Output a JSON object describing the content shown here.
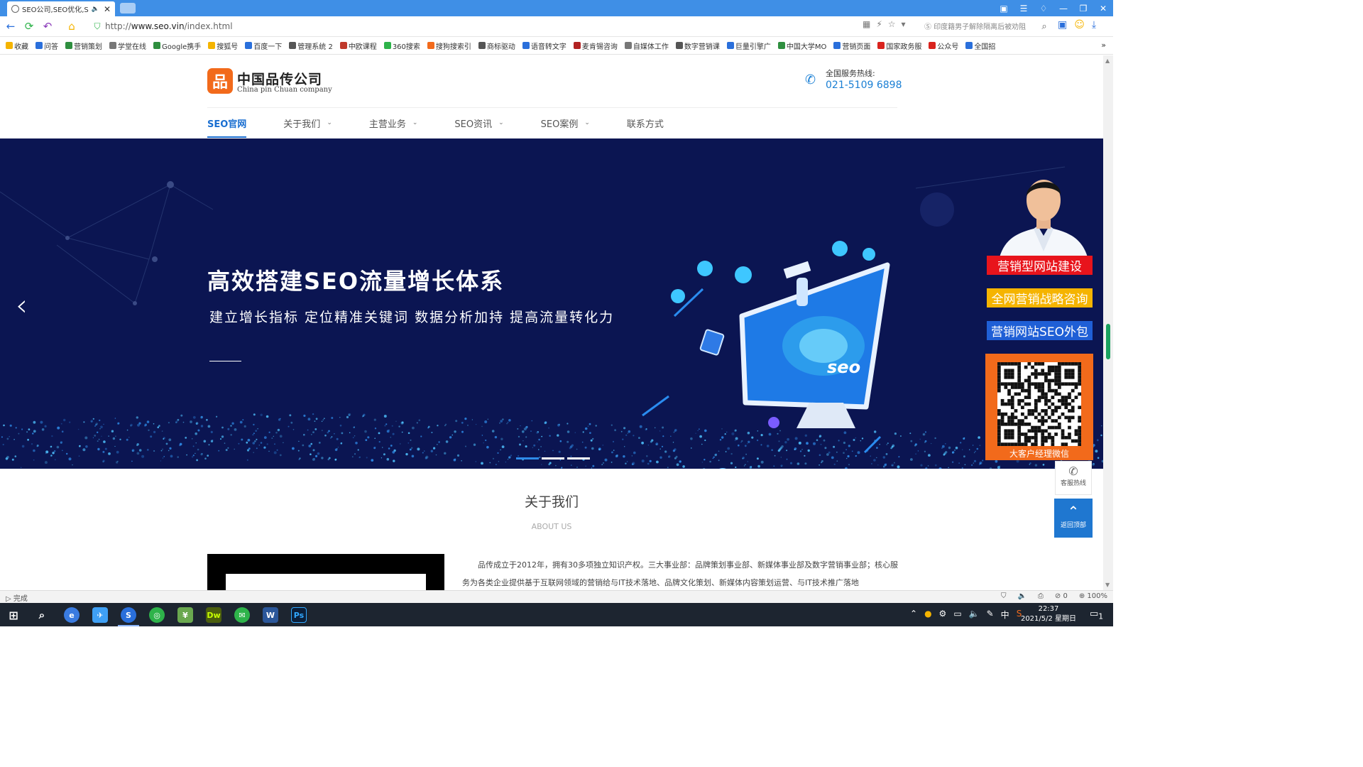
{
  "browser": {
    "tab_title": "SEO公司,SEO优化,S",
    "url_prefix": "http://",
    "url_host": "www.seo.vin",
    "url_path": "/index.html",
    "search_hint": "印度籍男子解除隔离后被劝阻",
    "status_text": "完成",
    "zoom": "100%",
    "adblock_count": "0"
  },
  "bookmarks": [
    {
      "label": "收藏",
      "color": "#f5b400"
    },
    {
      "label": "问答",
      "color": "#2a6fdb"
    },
    {
      "label": "营销策划",
      "color": "#2f8f3f"
    },
    {
      "label": "学堂在线",
      "color": "#777777"
    },
    {
      "label": "Google携手",
      "color": "#2f8f3f"
    },
    {
      "label": "搜狐号",
      "color": "#f5b400"
    },
    {
      "label": "百度一下",
      "color": "#2a6fdb"
    },
    {
      "label": "管理系统 2",
      "color": "#555555"
    },
    {
      "label": "中欧课程",
      "color": "#c0392b"
    },
    {
      "label": "360搜索",
      "color": "#2eb34a"
    },
    {
      "label": "搜狗搜索引",
      "color": "#f26a1b"
    },
    {
      "label": "商标驱动",
      "color": "#555555"
    },
    {
      "label": "语音转文字",
      "color": "#2a6fdb"
    },
    {
      "label": "麦肯锡咨询",
      "color": "#b22222"
    },
    {
      "label": "自媒体工作",
      "color": "#777777"
    },
    {
      "label": "数字营销课",
      "color": "#555555"
    },
    {
      "label": "巨量引擎广",
      "color": "#2a6fdb"
    },
    {
      "label": "中国大学MO",
      "color": "#2f8f3f"
    },
    {
      "label": "营销页面",
      "color": "#2a6fdb"
    },
    {
      "label": "国家政务服",
      "color": "#d9231d"
    },
    {
      "label": "公众号",
      "color": "#d9231d"
    },
    {
      "label": "全国招",
      "color": "#2a6fdb"
    }
  ],
  "site": {
    "logo_char": "品",
    "logo_name": "中国品传公司",
    "logo_en": "China pin Chuan company",
    "hotline_label": "全国服务热线:",
    "hotline_number": "021-5109 6898",
    "nav": [
      {
        "label": "SEO官网",
        "dropdown": false,
        "active": true
      },
      {
        "label": "关于我们",
        "dropdown": true,
        "active": false
      },
      {
        "label": "主营业务",
        "dropdown": true,
        "active": false
      },
      {
        "label": "SEO资讯",
        "dropdown": true,
        "active": false
      },
      {
        "label": "SEO案例",
        "dropdown": true,
        "active": false
      },
      {
        "label": "联系方式",
        "dropdown": false,
        "active": false
      }
    ]
  },
  "banner": {
    "headline": "高效搭建SEO流量增长体系",
    "subline": "建立增长指标 定位精准关键词  数据分析加持  提高流量转化力",
    "monitor_text": "seo",
    "slide_count": 3,
    "active_slide": 1
  },
  "sidebar": {
    "promos": [
      {
        "label": "营销型网站建设",
        "bg": "#e8141c"
      },
      {
        "label": "全网营销战略咨询",
        "bg": "#f5b400"
      },
      {
        "label": "营销网站SEO外包",
        "bg": "#1f5fd6"
      }
    ],
    "qr_caption": "大客户经理微信",
    "service_label": "客服热线",
    "back_top_label": "返回顶部"
  },
  "about": {
    "title": "关于我们",
    "subtitle": "ABOUT US",
    "text": "品传成立于2012年，拥有30多项独立知识产权。三大事业部：品牌策划事业部、新媒体事业部及数字营销事业部；核心服务为各类企业提供基于互联网领域的营销给与IT技术落地、品牌文化策划、新媒体内容策划运营、与IT技术推广落地"
  },
  "taskbar": {
    "time": "22:37",
    "date": "2021/5/2 星期日",
    "ime": "中",
    "notification_count": "1"
  }
}
